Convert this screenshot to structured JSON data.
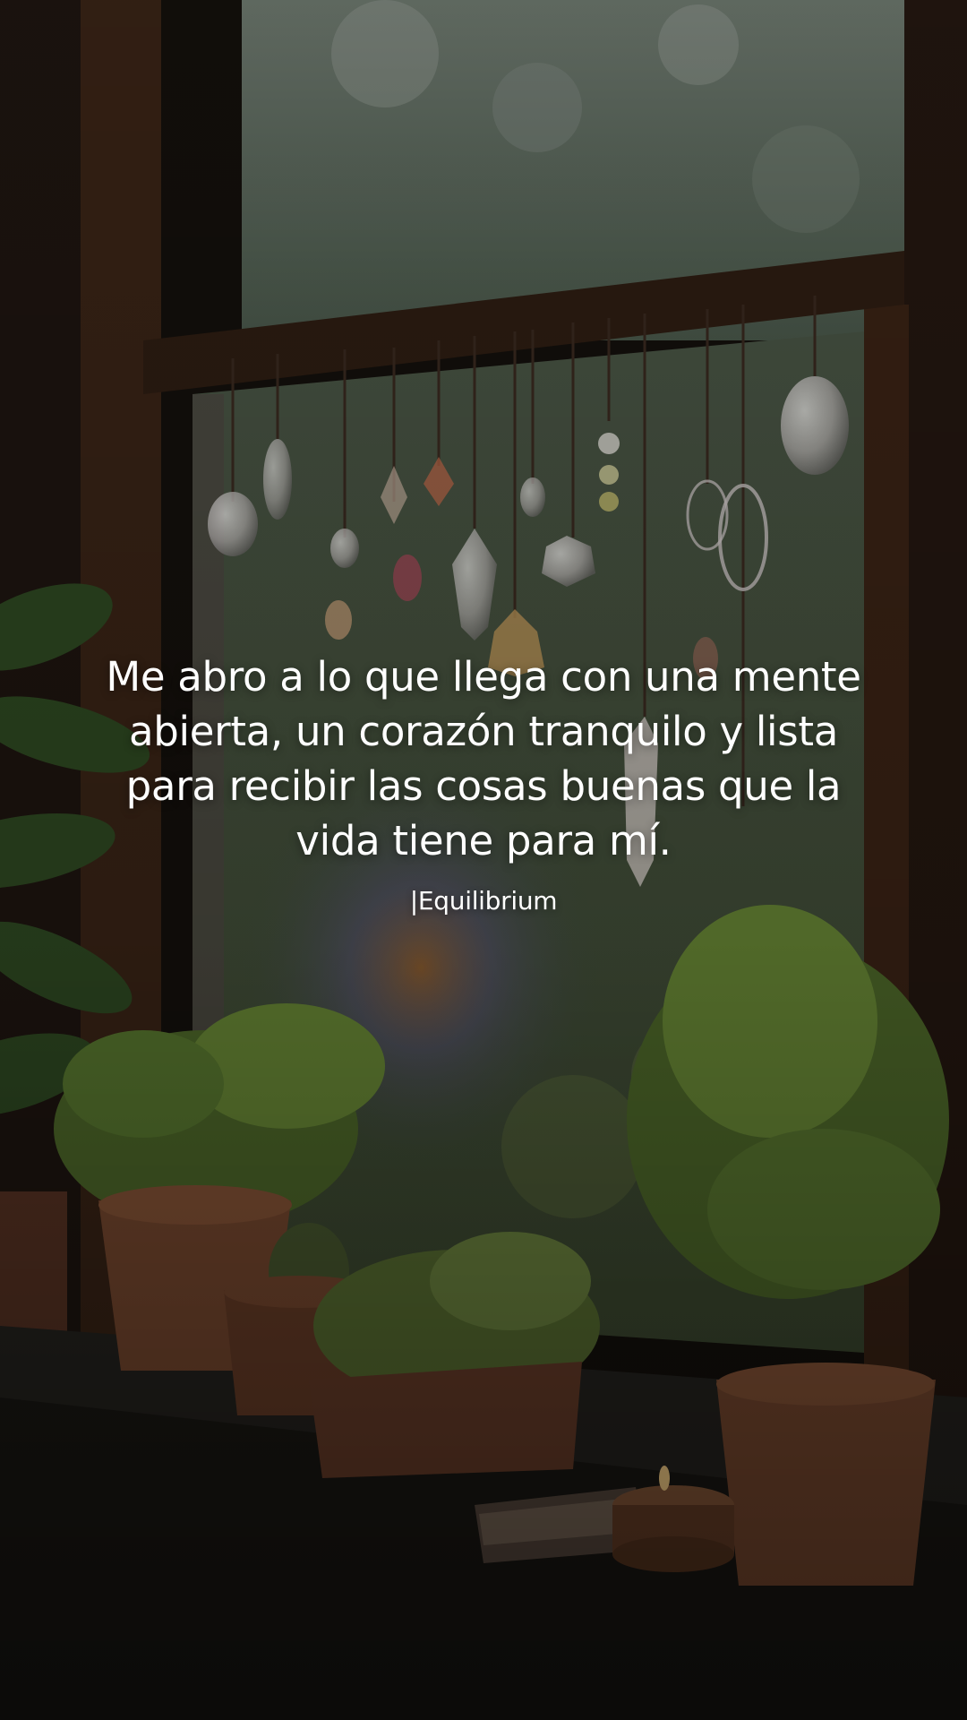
{
  "quote": {
    "text": "Me abro a lo que llega con una mente abierta, un corazón tranquilo y lista para recibir las cosas buenas que la vida tiene para mí.",
    "signature": "|Equilibrium"
  },
  "palette": {
    "frame": "#2a1a10",
    "glass": "#5a6a5c",
    "foliage": "#5d7a32",
    "pot": "#7a4a30",
    "sill": "#262420"
  }
}
